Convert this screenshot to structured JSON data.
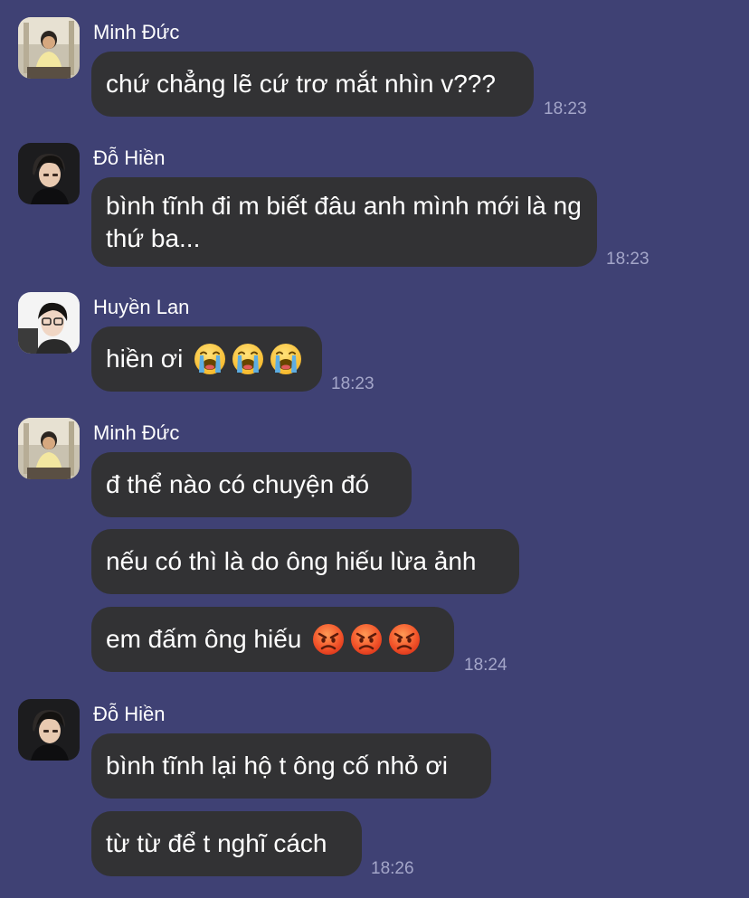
{
  "messages": [
    {
      "sender": "Minh Đức",
      "text": "chứ chẳng lẽ cứ trơ mắt nhìn v???",
      "time": "18:23"
    },
    {
      "sender": "Đỗ Hiền",
      "text": "bình tĩnh đi m biết đâu anh mình mới là ng thứ ba...",
      "time": "18:23"
    },
    {
      "sender": "Huyền Lan",
      "text": "hiền ơi",
      "emoji": "loudly-crying-face",
      "time": "18:23"
    },
    {
      "sender": "Minh Đức",
      "text": "đ thể nào có chuyện đó"
    },
    {
      "text": "nếu có thì là do ông hiếu lừa ảnh"
    },
    {
      "text": "em đấm ông hiếu",
      "emoji": "angry-face",
      "time": "18:24"
    },
    {
      "sender": "Đỗ Hiền",
      "text": "bình tĩnh lại hộ t ông cố nhỏ ơi"
    },
    {
      "text": "từ từ để t nghĩ cách",
      "time": "18:26"
    }
  ],
  "colors": {
    "background": "#3f4174",
    "bubble": "#323234",
    "text": "#ffffff",
    "time": "#a4a6c9"
  }
}
